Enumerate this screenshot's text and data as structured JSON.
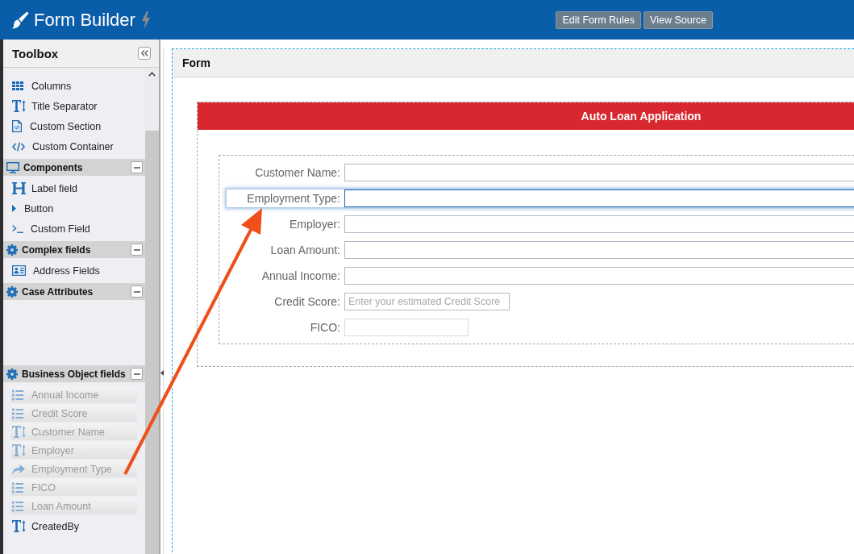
{
  "header": {
    "title": "Form Builder",
    "buttons": [
      "Edit Form Rules",
      "View Source"
    ]
  },
  "toolbox": {
    "title": "Toolbox",
    "sections": [
      {
        "items": [
          {
            "label": "Columns",
            "kind": "grid"
          },
          {
            "label": "Title Separator",
            "kind": "title"
          },
          {
            "label": "Custom Section",
            "kind": "section"
          },
          {
            "label": "Custom Container",
            "kind": "container"
          }
        ]
      },
      {
        "title": "Components",
        "kind": "display",
        "expanded": true,
        "items": [
          {
            "label": "Label field",
            "kind": "label"
          },
          {
            "label": "Button",
            "kind": "button"
          },
          {
            "label": "Custom Field",
            "kind": "custom"
          }
        ]
      },
      {
        "title": "Complex fields",
        "kind": "settings",
        "expanded": true,
        "items": [
          {
            "label": "Address Fields",
            "kind": "address"
          }
        ]
      },
      {
        "title": "Case Attributes",
        "kind": "settings",
        "expanded": true
      },
      {
        "title": "Business Object fields",
        "kind": "settings",
        "expanded": true,
        "items": [
          {
            "label": "Annual Income",
            "kind": "number",
            "disabled": true
          },
          {
            "label": "Credit Score",
            "kind": "number",
            "disabled": true
          },
          {
            "label": "Customer Name",
            "kind": "text",
            "disabled": true
          },
          {
            "label": "Employer",
            "kind": "text",
            "disabled": true
          },
          {
            "label": "Employment Type",
            "kind": "choice",
            "disabled": true
          },
          {
            "label": "FICO",
            "kind": "number",
            "disabled": true
          },
          {
            "label": "Loan Amount",
            "kind": "number",
            "disabled": true
          },
          {
            "label": "CreatedBy",
            "kind": "text",
            "disabled": false
          }
        ]
      }
    ]
  },
  "form": {
    "title": "Form",
    "section": {
      "title": "Auto Loan Application",
      "fields": [
        {
          "label": "Customer Name:",
          "kind": "text",
          "selected": false
        },
        {
          "label": "Employment Type:",
          "kind": "text",
          "selected": true
        },
        {
          "label": "Employer:",
          "kind": "text",
          "selected": false
        },
        {
          "label": "Loan Amount:",
          "kind": "text",
          "selected": false
        },
        {
          "label": "Annual Income:",
          "kind": "text",
          "selected": false
        },
        {
          "label": "Credit Score:",
          "kind": "number",
          "placeholder": "Enter your estimated Credit Score",
          "selected": false
        },
        {
          "label": "FICO:",
          "kind": "readonly",
          "selected": false
        }
      ]
    }
  }
}
